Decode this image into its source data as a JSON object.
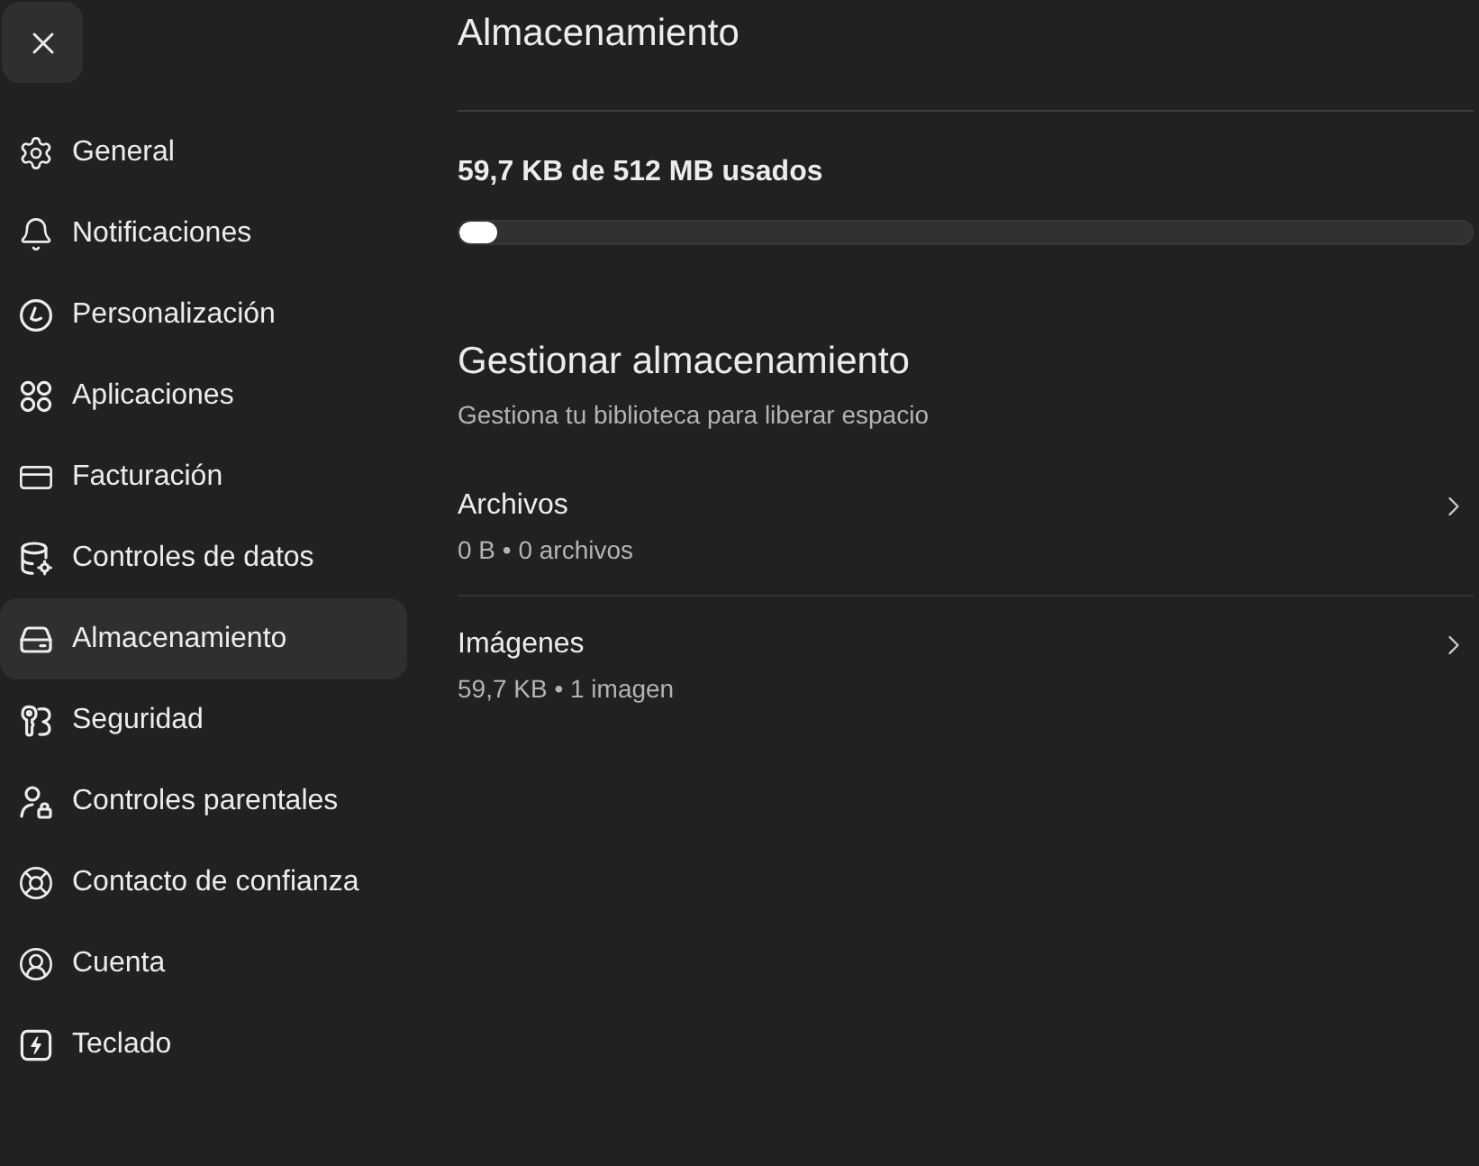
{
  "sidebar": {
    "items": [
      {
        "label": "General",
        "selected": false
      },
      {
        "label": "Notificaciones",
        "selected": false
      },
      {
        "label": "Personalización",
        "selected": false
      },
      {
        "label": "Aplicaciones",
        "selected": false
      },
      {
        "label": "Facturación",
        "selected": false
      },
      {
        "label": "Controles de datos",
        "selected": false
      },
      {
        "label": "Almacenamiento",
        "selected": true
      },
      {
        "label": "Seguridad",
        "selected": false
      },
      {
        "label": "Controles parentales",
        "selected": false
      },
      {
        "label": "Contacto de confianza",
        "selected": false
      },
      {
        "label": "Cuenta",
        "selected": false
      },
      {
        "label": "Teclado",
        "selected": false
      }
    ]
  },
  "storage": {
    "title": "Almacenamiento",
    "usage": {
      "label": "59,7 KB de 512 MB usados",
      "level": 0.037
    }
  },
  "manage": {
    "title": "Gestionar almacenamiento",
    "subtitle": "Gestiona tu biblioteca para liberar espacio",
    "rows": [
      {
        "title": "Archivos",
        "details": "0 B • 0 archivos"
      },
      {
        "title": "Imágenes",
        "details": "59,7 KB • 1 imagen"
      }
    ]
  }
}
